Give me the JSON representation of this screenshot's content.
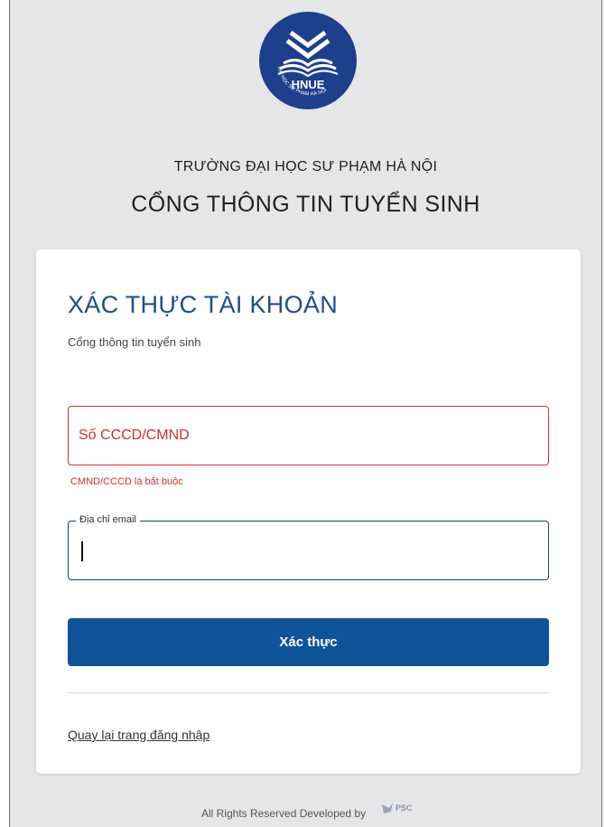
{
  "header": {
    "logo_text": "HNUE",
    "logo_ring_text": "ĐẠI HỌC SƯ PHẠM HÀ NỘI",
    "school_name": "TRƯỜNG ĐẠI HỌC SƯ PHẠM HÀ NỘI",
    "portal_name": "CỔNG THÔNG TIN TUYỂN SINH"
  },
  "card": {
    "title": "XÁC THỰC TÀI KHOẢN",
    "subtitle": "Cổng thông tin tuyển sinh"
  },
  "form": {
    "id_field": {
      "placeholder": "Số CCCD/CMND",
      "value": "",
      "error": "CMND/CCCD là bắt buộc"
    },
    "email_field": {
      "label": "Địa chỉ email",
      "value": ""
    },
    "submit_label": "Xác thực"
  },
  "links": {
    "back_to_login": "Quay lại trang đăng nhập"
  },
  "footer": {
    "text": "All Rights Reserved Developed by",
    "brand": "PSC"
  },
  "colors": {
    "primary": "#0f5499",
    "title": "#1c4f8a",
    "error": "#d32f2f",
    "background": "#e6e6e8"
  }
}
